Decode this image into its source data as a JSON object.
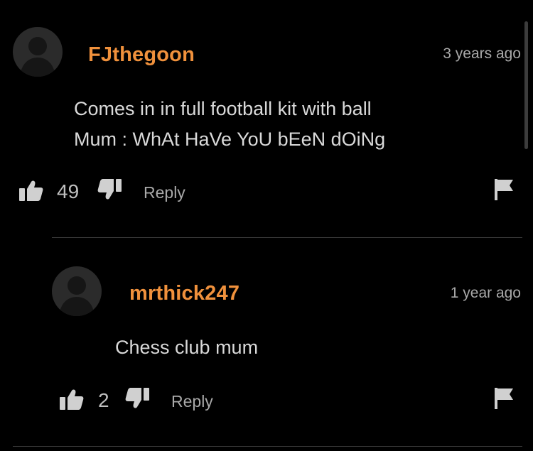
{
  "comments": [
    {
      "username": "FJthegoon",
      "timestamp": "3 years ago",
      "lines": [
        "Comes in in full football kit with ball",
        "Mum : WhAt HaVe YoU bEeN dOiNg"
      ],
      "likes": "49",
      "reply_label": "Reply",
      "icons": {
        "avatar": "default-avatar-icon",
        "like": "thumbs-up-icon",
        "dislike": "thumbs-down-icon",
        "flag": "flag-icon"
      }
    },
    {
      "username": "mrthick247",
      "timestamp": "1 year ago",
      "lines": [
        "Chess club mum"
      ],
      "likes": "2",
      "reply_label": "Reply",
      "icons": {
        "avatar": "default-avatar-icon",
        "like": "thumbs-up-icon",
        "dislike": "thumbs-down-icon",
        "flag": "flag-icon"
      }
    }
  ],
  "colors": {
    "background": "#000000",
    "username": "#f0913c",
    "text": "#d9d9d9",
    "muted": "#a9a9a9",
    "icon": "#d0d0d0"
  }
}
